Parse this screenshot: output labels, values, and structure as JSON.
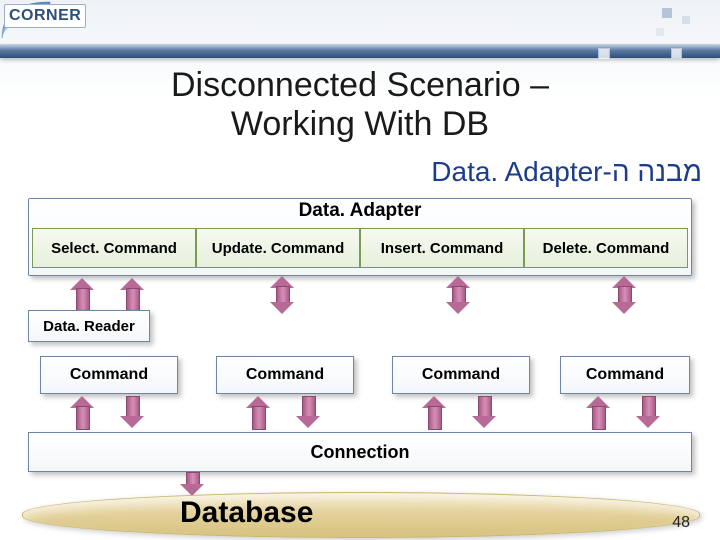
{
  "logo": "CORNER",
  "title_line1": "Disconnected Scenario –",
  "title_line2": "Working With DB",
  "subtitle_hebrew": "מבנה ה-",
  "subtitle_latin": "Data. Adapter",
  "adapter": {
    "title": "Data. Adapter",
    "commands": [
      "Select. Command",
      "Update. Command",
      "Insert. Command",
      "Delete. Command"
    ]
  },
  "data_reader": "Data. Reader",
  "command_boxes": [
    "Command",
    "Command",
    "Command",
    "Command"
  ],
  "connection": "Connection",
  "database": "Database",
  "slide_number": "48"
}
